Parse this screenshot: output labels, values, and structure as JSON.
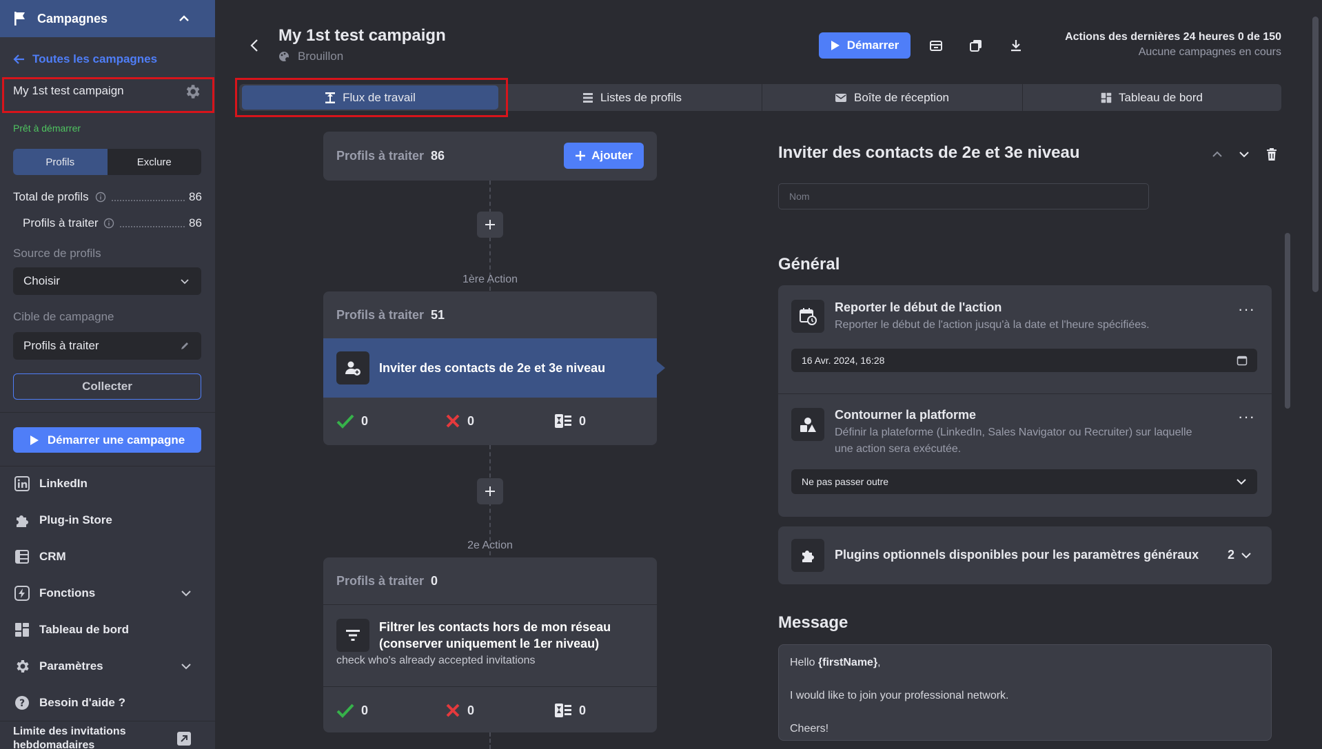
{
  "sidebar": {
    "section_title": "Campagnes",
    "back_link": "Toutes les campagnes",
    "campaign_name": "My 1st test campaign",
    "status": "Prêt à démarrer",
    "segment": {
      "profiles": "Profils",
      "exclude": "Exclure"
    },
    "total_label": "Total de profils",
    "total_value": "86",
    "to_process_label": "Profils à traiter",
    "to_process_value": "86",
    "source_label": "Source de profils",
    "source_value": "Choisir",
    "target_label": "Cible de campagne",
    "target_value": "Profils à traiter",
    "collect_button": "Collecter",
    "start_button": "Démarrer une campagne",
    "nav": [
      {
        "label": "LinkedIn"
      },
      {
        "label": "Plug-in Store"
      },
      {
        "label": "CRM"
      },
      {
        "label": "Fonctions"
      },
      {
        "label": "Tableau de bord"
      },
      {
        "label": "Paramètres"
      },
      {
        "label": "Besoin d'aide ?"
      }
    ],
    "limit_label": "Limite des invitations hebdomadaires"
  },
  "header": {
    "title": "My 1st test campaign",
    "subtitle": "Brouillon",
    "start_button": "Démarrer",
    "actions_line1": "Actions des dernières 24 heures 0 de 150",
    "actions_line2": "Aucune campagnes en cours"
  },
  "tabs": [
    {
      "label": "Flux de travail",
      "active": true
    },
    {
      "label": "Listes de profils"
    },
    {
      "label": "Boîte de réception"
    },
    {
      "label": "Tableau de bord"
    }
  ],
  "workflow": {
    "profiles_label": "Profils à traiter",
    "root_count": "86",
    "add_button": "Ajouter",
    "actions": [
      {
        "label": "1ère Action",
        "count": "51",
        "title": "Inviter des contacts de 2e et 3e niveau",
        "stats": {
          "success": "0",
          "fail": "0",
          "pending": "0"
        }
      },
      {
        "label": "2e Action",
        "count": "0",
        "title_line1": "Filtrer les contacts hors de mon réseau",
        "title_line2": "(conserver uniquement le 1er niveau)",
        "note": "check who's already accepted invitations",
        "stats": {
          "success": "0",
          "fail": "0",
          "pending": "0"
        }
      }
    ]
  },
  "panel": {
    "title": "Inviter des contacts de 2e et 3e niveau",
    "name_placeholder": "Nom",
    "general_heading": "Général",
    "delay": {
      "title": "Reporter le début de l'action",
      "desc": "Reporter le début de l'action jusqu'à la date et l'heure spécifiées.",
      "value": "16 Avr. 2024, 16:28"
    },
    "bypass": {
      "title": "Contourner la platforme",
      "desc_line1": "Définir la plateforme (LinkedIn, Sales Navigator ou Recruiter) sur laquelle",
      "desc_line2": "une action sera exécutée.",
      "value": "Ne pas passer outre"
    },
    "plugins": {
      "title": "Plugins optionnels disponibles pour les paramètres généraux",
      "count": "2"
    },
    "message_heading": "Message",
    "message": {
      "line1_prefix": "Hello ",
      "line1_var": "{firstName}",
      "line1_suffix": ",",
      "line2": "I would like to join your professional network.",
      "line3": "Cheers!"
    }
  },
  "colors": {
    "accent": "#4f7ef8",
    "sidebar_active": "#3b5386",
    "highlight": "#d7141b",
    "success": "#36b24a",
    "danger": "#e5393c",
    "status": "#4fc460"
  }
}
